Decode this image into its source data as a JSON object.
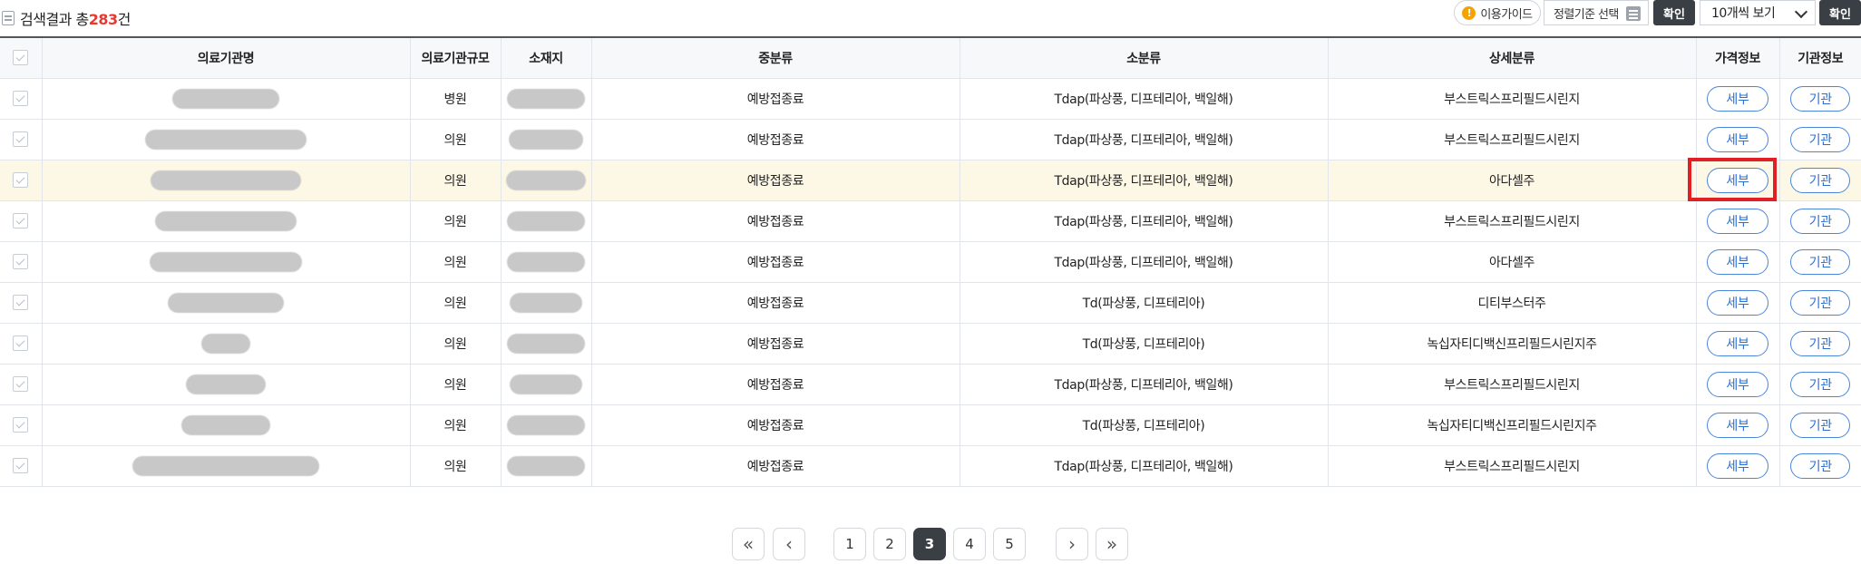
{
  "toolbar": {
    "result_prefix": "검색결과 총",
    "result_count": "283",
    "result_suffix": "건",
    "guide_label": "이용가이드",
    "sort_label": "정렬기준 선택",
    "confirm_label_1": "확인",
    "per_page_label": "10개씩 보기",
    "confirm_label_2": "확인"
  },
  "table": {
    "headers": [
      "의료기관명",
      "의료기관규모",
      "소재지",
      "중분류",
      "소분류",
      "상세분류",
      "가격정보",
      "기관정보"
    ],
    "rows": [
      {
        "scale": "병원",
        "mid": "예방접종료",
        "sub": "Tdap(파상풍, 디프테리아, 백일해)",
        "detail": "부스트릭스프리필드시린지",
        "price_btn": "세부",
        "org_btn": "기관"
      },
      {
        "scale": "의원",
        "mid": "예방접종료",
        "sub": "Tdap(파상풍, 디프테리아, 백일해)",
        "detail": "부스트릭스프리필드시린지",
        "price_btn": "세부",
        "org_btn": "기관"
      },
      {
        "scale": "의원",
        "mid": "예방접종료",
        "sub": "Tdap(파상풍, 디프테리아, 백일해)",
        "detail": "아다셀주",
        "price_btn": "세부",
        "org_btn": "기관"
      },
      {
        "scale": "의원",
        "mid": "예방접종료",
        "sub": "Tdap(파상풍, 디프테리아, 백일해)",
        "detail": "부스트릭스프리필드시린지",
        "price_btn": "세부",
        "org_btn": "기관"
      },
      {
        "scale": "의원",
        "mid": "예방접종료",
        "sub": "Tdap(파상풍, 디프테리아, 백일해)",
        "detail": "아다셀주",
        "price_btn": "세부",
        "org_btn": "기관"
      },
      {
        "scale": "의원",
        "mid": "예방접종료",
        "sub": "Td(파상풍, 디프테리아)",
        "detail": "디티부스터주",
        "price_btn": "세부",
        "org_btn": "기관"
      },
      {
        "scale": "의원",
        "mid": "예방접종료",
        "sub": "Td(파상풍, 디프테리아)",
        "detail": "녹십자티디백신프리필드시린지주",
        "price_btn": "세부",
        "org_btn": "기관"
      },
      {
        "scale": "의원",
        "mid": "예방접종료",
        "sub": "Tdap(파상풍, 디프테리아, 백일해)",
        "detail": "부스트릭스프리필드시린지",
        "price_btn": "세부",
        "org_btn": "기관"
      },
      {
        "scale": "의원",
        "mid": "예방접종료",
        "sub": "Td(파상풍, 디프테리아)",
        "detail": "녹십자티디백신프리필드시린지주",
        "price_btn": "세부",
        "org_btn": "기관"
      },
      {
        "scale": "의원",
        "mid": "예방접종료",
        "sub": "Tdap(파상풍, 디프테리아, 백일해)",
        "detail": "부스트릭스프리필드시린지",
        "price_btn": "세부",
        "org_btn": "기관"
      }
    ]
  },
  "pagination": {
    "pages": [
      "1",
      "2",
      "3",
      "4",
      "5"
    ],
    "current": "3",
    "first_icon": "double-chevron-left-icon",
    "prev_icon": "chevron-left-icon",
    "next_icon": "chevron-right-icon",
    "last_icon": "double-chevron-right-icon"
  },
  "colors": {
    "count_highlight": "#e8382f",
    "highlight_row": "#fdf8e6",
    "highlight_box": "#e01f26",
    "pill_blue": "#2d6fcf"
  }
}
